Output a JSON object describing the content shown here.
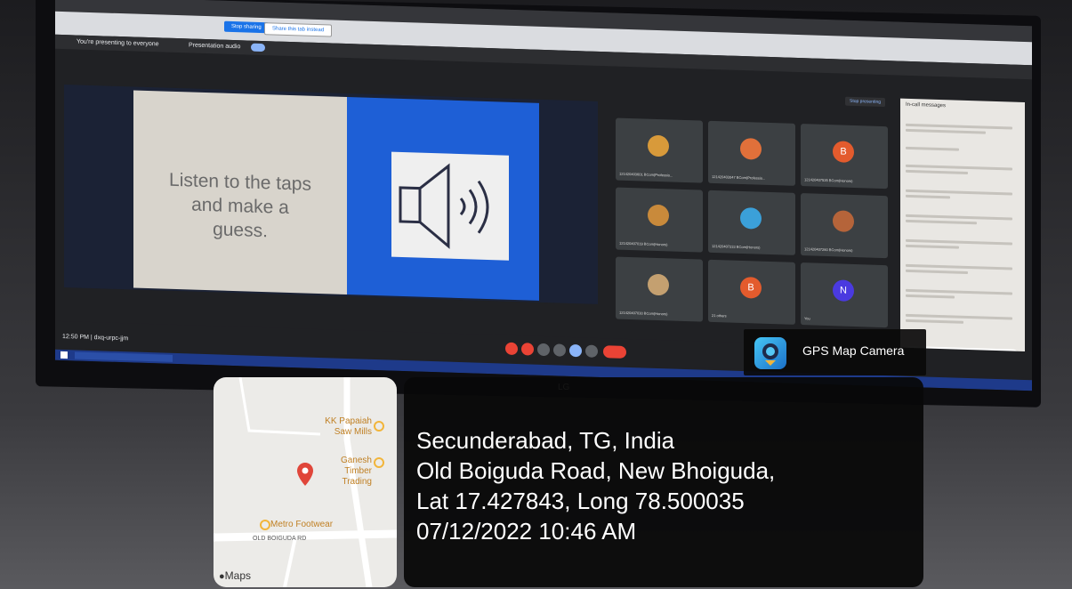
{
  "slide": {
    "text_line1": "Listen to the taps",
    "text_line2": "and make a",
    "text_line3": "guess."
  },
  "meeting": {
    "presenting_text": "You're presenting to everyone",
    "presentation_audio_label": "Presentation audio",
    "stop_sharing_label": "Stop sharing",
    "switch_tab_label": "Share this tab instead",
    "stop_presenting_label": "Stop presenting",
    "time_code": "12:50 PM | dxq-urpc-jjm",
    "chat_title": "In-call messages"
  },
  "participants": [
    {
      "label": "121420403601 BCom(Professio...",
      "avatar_color": "#d89a3a",
      "letter": ""
    },
    {
      "label": "121420403047 BCom(Professio...",
      "avatar_color": "#e0703a",
      "letter": ""
    },
    {
      "label": "121420407535 BCom(Honors)",
      "avatar_color": "#e35b2d",
      "letter": "B"
    },
    {
      "label": "121420407019 BCom(Honors)",
      "avatar_color": "#c98a3b",
      "letter": ""
    },
    {
      "label": "121420407233 BCom(Honors)",
      "avatar_color": "#3ba0d9",
      "letter": ""
    },
    {
      "label": "121420407260 BCom(Honors)",
      "avatar_color": "#b5643a",
      "letter": ""
    },
    {
      "label": "121420407030 BCom(Honors)",
      "avatar_color": "#c4a070",
      "letter": ""
    },
    {
      "label": "21 others",
      "avatar_color": "#e35b2d",
      "letter": "B"
    },
    {
      "label": "You",
      "avatar_color": "#4a3ae0",
      "letter": "N"
    }
  ],
  "gps_badge": {
    "label": "GPS Map Camera"
  },
  "map": {
    "poi1": "KK Papaiah Saw Mills",
    "poi2": "Ganesh Timber Trading",
    "poi3": "Metro Footwear",
    "road": "OLD BOIGUDA RD",
    "brand": "Maps"
  },
  "location": {
    "line1": "Secunderabad, TG, India",
    "line2": "Old Boiguda Road, New Bhoiguda,",
    "line3": "Lat 17.427843, Long 78.500035",
    "line4": "07/12/2022 10:46 AM"
  },
  "monitor_brand": "LG",
  "colors": {
    "accent": "#1a73e8",
    "end_call": "#ea4335"
  }
}
